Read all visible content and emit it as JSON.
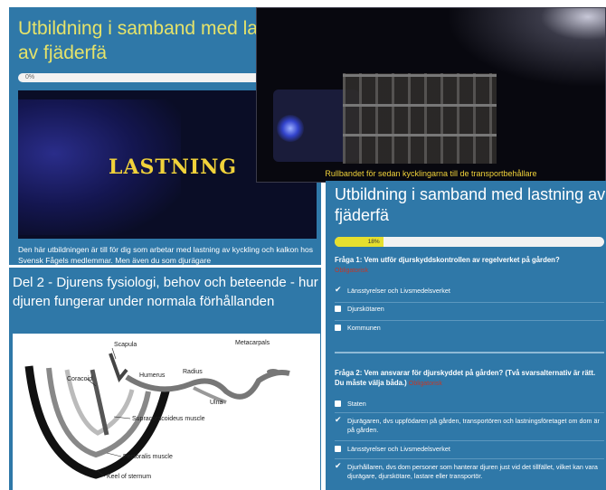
{
  "course_page": {
    "title": "Utbildning i samband med lastning av fjäderfä",
    "progress_label": "0%",
    "video_title": "LASTNING",
    "intro_text": "Den här utbildningen är till för dig som arbetar med lastning av kyckling och kalkon hos Svensk Fågels medlemmar. Men även du som djurägare"
  },
  "photo": {
    "caption": "Rullbandet för sedan kycklingarna till de transportbehållare"
  },
  "lesson": {
    "heading": "Del 2 - Djurens fysiologi, behov och beteende - hur djuren fungerar under normala förhållanden",
    "diagram_labels": [
      "Scapula",
      "Metacarpals",
      "Coracoid",
      "Humerus",
      "Radius",
      "Ulna",
      "Supracoracoideus muscle",
      "Pectoralis muscle",
      "Keel of sternum"
    ]
  },
  "quiz": {
    "title": "Utbildning i samband med lastning av fjäderfä",
    "progress_label": "18%",
    "progress_value": 18,
    "q1": {
      "text": "Fråga 1: Vem utför djurskyddskontrollen av regelverket på gården?",
      "required": "Obligatorisk",
      "options": [
        {
          "label": "Länsstyrelser och Livsmedelsverket",
          "checked": true
        },
        {
          "label": "Djurskötaren",
          "checked": false
        },
        {
          "label": "Kommunen",
          "checked": false
        }
      ]
    },
    "q2": {
      "text": "Fråga 2: Vem ansvarar för djurskyddet på gården? (Två svarsalternativ är rätt. Du måste välja båda.)",
      "required": "Obligatorisk",
      "options": [
        {
          "label": "Staten",
          "checked": false
        },
        {
          "label": "Djurägaren, dvs uppfödaren på gården, transportören och lastningsföretaget om dom är på gården.",
          "checked": true
        },
        {
          "label": "Länsstyrelser och Livsmedelsverket",
          "checked": false
        },
        {
          "label": "Djurhållaren, dvs dom personer som hanterar djuren just vid det tillfället, vilket kan vara djurägare, djurskötare, lastare eller transportör.",
          "checked": true
        }
      ]
    }
  }
}
